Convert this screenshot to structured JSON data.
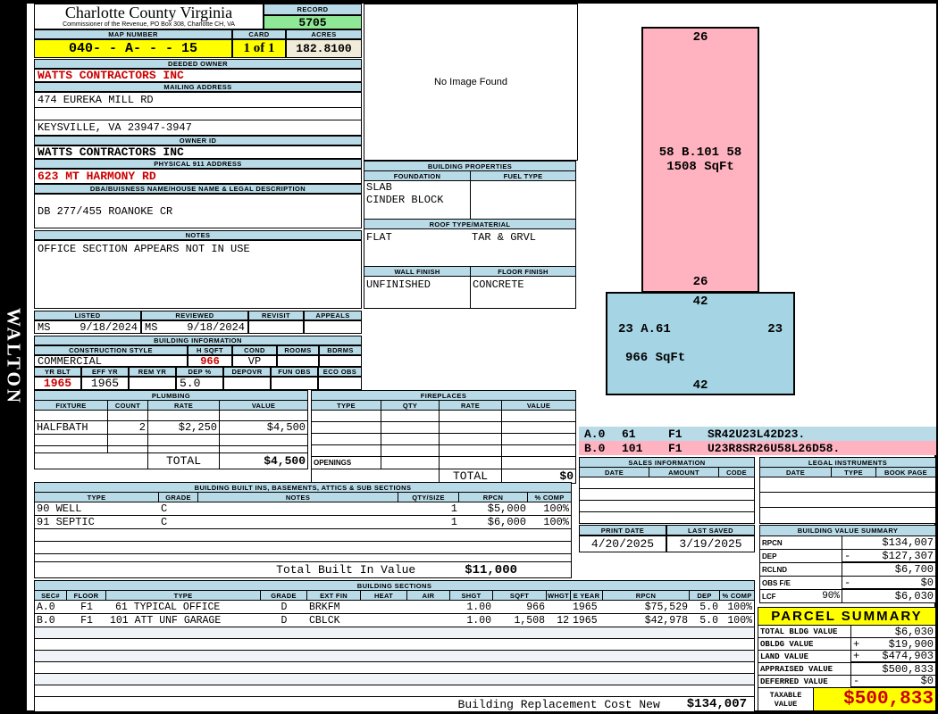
{
  "colors": {
    "header_blue": "#B9DBE8",
    "record_green": "#8FE896",
    "highlight_yellow": "#FFFF00",
    "acres_cream": "#F1ECD9",
    "alert_red": "#CC0000",
    "sketch_pink": "#FFB3C0",
    "sketch_blue": "#A5D5E4",
    "stripe": "#F0F3F8"
  },
  "watermark": "WALTON",
  "header": {
    "county_title": "Charlotte County Virginia",
    "county_subtitle": "Commissioner of the Revenue, PO Box 308, Charlotte CH, VA",
    "record_label": "RECORD",
    "record_value": "5705",
    "map_number_label": "MAP NUMBER",
    "map_number": "040- - A- - - 15",
    "card_label": "CARD",
    "card_value": "1 of 1",
    "acres_label": "ACRES",
    "acres_value": "182.8100"
  },
  "owner": {
    "deeded_owner_label": "DEEDED OWNER",
    "deeded_owner": "WATTS CONTRACTORS INC",
    "mailing_label": "MAILING ADDRESS",
    "mailing_line1": "474 EUREKA MILL RD",
    "mailing_line2": "KEYSVILLE, VA 23947-3947",
    "owner_id_label": "OWNER ID",
    "owner_id": "WATTS CONTRACTORS INC",
    "physical_label": "PHYSICAL 911 ADDRESS",
    "physical_address": "623 MT HARMONY RD",
    "dba_label": "DBA/BUISNESS NAME/HOUSE NAME & LEGAL DESCRIPTION",
    "dba_value": "DB 277/455 ROANOKE CR",
    "notes_label": "NOTES",
    "notes_value": "OFFICE SECTION APPEARS NOT IN USE"
  },
  "photo": {
    "placeholder": "No Image Found"
  },
  "properties": {
    "title": "BUILDING PROPERTIES",
    "foundation_label": "FOUNDATION",
    "fuel_label": "FUEL TYPE",
    "foundation_line1": "SLAB",
    "foundation_line2": "CINDER BLOCK",
    "roof_label": "ROOF TYPE/MATERIAL",
    "roof_type": "FLAT",
    "roof_material": "TAR & GRVL",
    "wall_label": "WALL FINISH",
    "floor_label": "FLOOR FINISH",
    "wall_finish": "UNFINISHED",
    "floor_finish": "CONCRETE"
  },
  "visits": {
    "listed_label": "LISTED",
    "listed_by": "MS",
    "listed_date": "9/18/2024",
    "reviewed_label": "REVIEWED",
    "reviewed_by": "MS",
    "reviewed_date": "9/18/2024",
    "revisit_label": "REVISIT",
    "appeals_label": "APPEALS"
  },
  "building_info": {
    "title": "BUILDING INFORMATION",
    "style_label": "CONSTRUCTION STYLE",
    "style": "COMMERCIAL",
    "hsqft_label": "H SQFT",
    "hsqft": "966",
    "cond_label": "COND",
    "cond": "VP",
    "rooms_label": "ROOMS",
    "bdrms_label": "BDRMS",
    "yrblt_label": "YR BLT",
    "yrblt": "1965",
    "effyr_label": "EFF YR",
    "effyr": "1965",
    "remyr_label": "REM YR",
    "dep_label": "DEP %",
    "dep": "5.0",
    "depovr_label": "DEPOVR",
    "funobs_label": "FUN OBS",
    "ecoobs_label": "ECO OBS"
  },
  "plumbing": {
    "title": "PLUMBING",
    "headers": [
      "FIXTURE",
      "COUNT",
      "RATE",
      "VALUE"
    ],
    "row": {
      "fixture": "HALFBATH",
      "count": "2",
      "rate": "$2,250",
      "value": "$4,500"
    },
    "total_label": "TOTAL",
    "total_value": "$4,500"
  },
  "fireplaces": {
    "title": "FIREPLACES",
    "headers": [
      "TYPE",
      "QTY",
      "RATE",
      "VALUE"
    ],
    "openings_label": "OPENINGS",
    "total_label": "TOTAL",
    "total_value": "$0"
  },
  "builtins": {
    "title": "BUILDING BUILT INS, BASEMENTS, ATTICS & SUB SECTIONS",
    "headers": [
      "TYPE",
      "GRADE",
      "NOTES",
      "QTY/SIZE",
      "RPCN",
      "% COMP"
    ],
    "rows": [
      {
        "type": "90 WELL",
        "grade": "C",
        "qty": "1",
        "rpcn": "$5,000",
        "comp": "100%"
      },
      {
        "type": "91 SEPTIC",
        "grade": "C",
        "qty": "1",
        "rpcn": "$6,000",
        "comp": "100%"
      }
    ],
    "total_label": "Total Built In Value",
    "total_value": "$11,000"
  },
  "sections": {
    "title": "BUILDING SECTIONS",
    "headers": [
      "SEC#",
      "FLOOR",
      "TYPE",
      "GRADE",
      "EXT FIN",
      "HEAT",
      "AIR",
      "SHGT",
      "SQFT",
      "WHGT",
      "E YEAR",
      "RPCN",
      "DEP",
      "% COMP"
    ],
    "rows": [
      {
        "sec": "A.0",
        "floor": "F1",
        "type": "61 TYPICAL OFFICE",
        "grade": "D",
        "extfin": "BRKFM",
        "shgt": "1.00",
        "sqft": "966",
        "whgt": "",
        "eyear": "1965",
        "rpcn": "$75,529",
        "dep": "5.0",
        "comp": "100%"
      },
      {
        "sec": "B.0",
        "floor": "F1",
        "type": "101 ATT UNF GARAGE",
        "grade": "D",
        "extfin": "CBLCK",
        "shgt": "1.00",
        "sqft": "1,508",
        "whgt": "12",
        "eyear": "1965",
        "rpcn": "$42,978",
        "dep": "5.0",
        "comp": "100%"
      }
    ],
    "rcn_label": "Building Replacement Cost New",
    "rcn_value": "$134,007"
  },
  "sketch": {
    "b101": {
      "top": "26",
      "center": "58 B.101 58",
      "sqft": "1508 SqFt",
      "bottom": "26"
    },
    "a61": {
      "top": "42",
      "left": "23 A.61",
      "right": "23",
      "sqft": "966 SqFt",
      "bottom": "42"
    },
    "legend": [
      {
        "sec": "A.0",
        "code": "61",
        "floor": "F1",
        "trace": "SR42U23L42D23."
      },
      {
        "sec": "B.0",
        "code": "101",
        "floor": "F1",
        "trace": "U23R8SR26U58L26D58."
      }
    ]
  },
  "sales": {
    "title": "SALES INFORMATION",
    "headers": [
      "DATE",
      "AMOUNT",
      "CODE"
    ]
  },
  "legal": {
    "title": "LEGAL INSTRUMENTS",
    "headers": [
      "DATE",
      "TYPE",
      "BOOK PAGE"
    ]
  },
  "dates": {
    "print_label": "PRINT DATE",
    "print_date": "4/20/2025",
    "saved_label": "LAST SAVED",
    "saved_date": "3/19/2025"
  },
  "value_summary": {
    "title": "BUILDING VALUE SUMMARY",
    "rows": [
      {
        "label": "RPCN",
        "op": "",
        "value": "$134,007"
      },
      {
        "label": "DEP",
        "op": "-",
        "value": "$127,307"
      },
      {
        "label": "RCLND",
        "op": "",
        "value": "$6,700"
      },
      {
        "label": "OBS F/E",
        "op": "-",
        "value": "$0"
      },
      {
        "label": "LCF",
        "pct": "90%",
        "op": "",
        "value": "$6,030"
      }
    ]
  },
  "parcel": {
    "title": "PARCEL SUMMARY",
    "rows": [
      {
        "label": "TOTAL BLDG VALUE",
        "op": "",
        "value": "$6,030"
      },
      {
        "label": "OBLDG VALUE",
        "op": "+",
        "value": "$19,900"
      },
      {
        "label": "LAND VALUE",
        "op": "+",
        "value": "$474,903"
      },
      {
        "label": "APPRAISED VALUE",
        "op": "",
        "value": "$500,833"
      },
      {
        "label": "DEFERRED VALUE",
        "op": "-",
        "value": "$0"
      }
    ],
    "taxable_label": "TAXABLE VALUE",
    "taxable_value": "$500,833"
  }
}
